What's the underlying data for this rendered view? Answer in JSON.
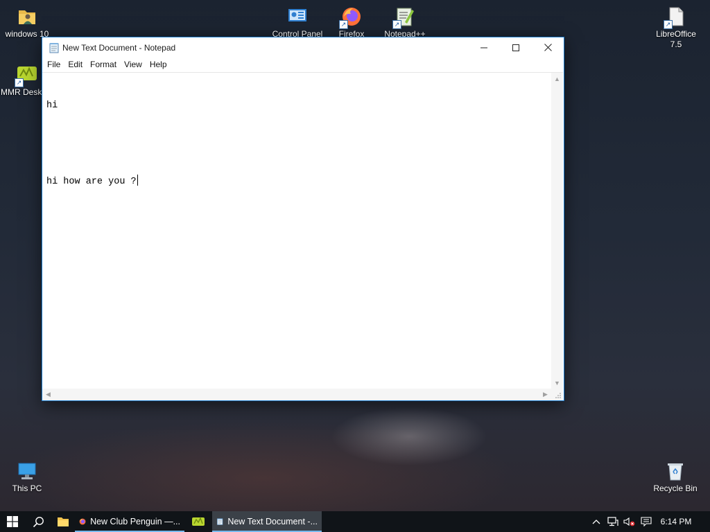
{
  "desktop": {
    "icons": [
      {
        "label": "windows 10"
      },
      {
        "label": "MMR Desktop"
      },
      {
        "label": "Control Panel"
      },
      {
        "label": "Firefox"
      },
      {
        "label": "Notepad++"
      },
      {
        "label": "LibreOffice 7.5"
      },
      {
        "label": "This PC"
      },
      {
        "label": "Recycle Bin"
      }
    ]
  },
  "notepad": {
    "title": "New Text Document - Notepad",
    "menu": [
      "File",
      "Edit",
      "Format",
      "View",
      "Help"
    ],
    "content_lines": [
      "hi",
      "",
      "hi how are you ?"
    ]
  },
  "taskbar": {
    "apps": [
      {
        "label": "New Club Penguin —..."
      },
      {
        "label": "New Text Document -..."
      }
    ],
    "clock": "6:14 PM"
  },
  "colors": {
    "window_border": "#1979ca",
    "taskbar_bg": "#101418",
    "taskbar_active": "#3b4148",
    "taskbar_indicator": "#76b9ed"
  }
}
